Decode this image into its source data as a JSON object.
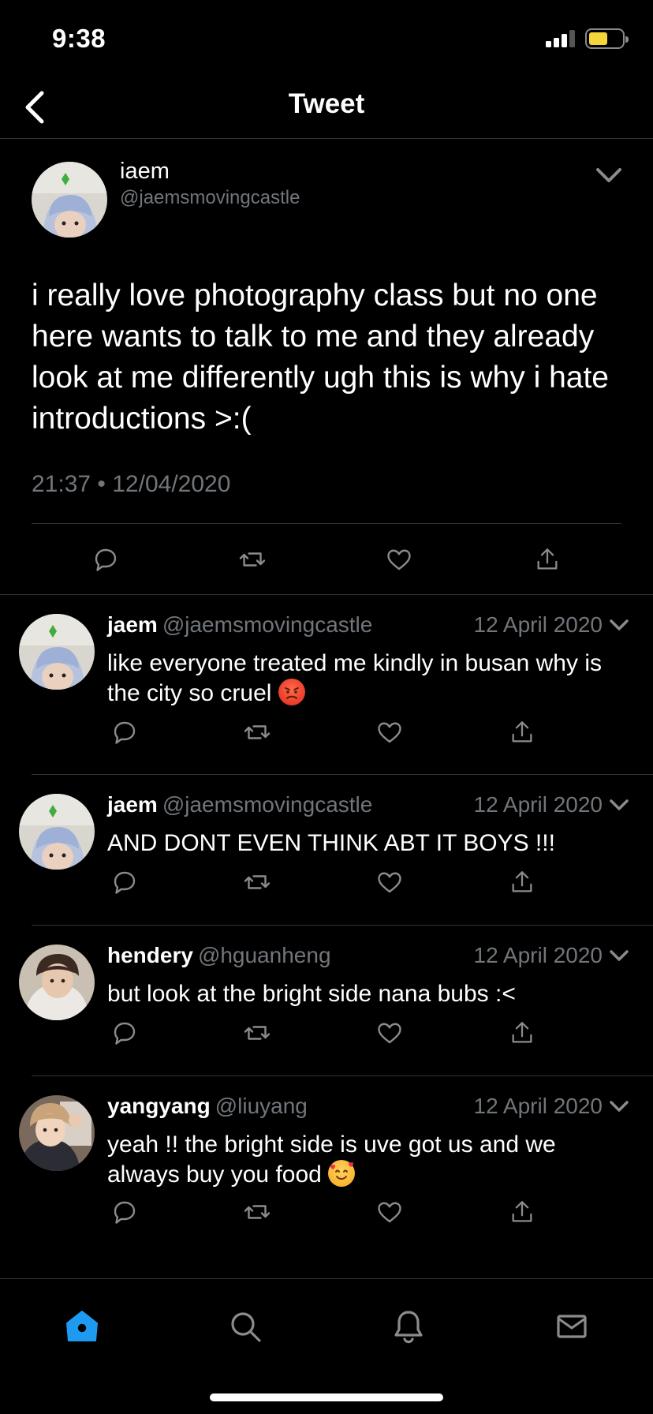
{
  "status_bar": {
    "time": "9:38"
  },
  "header": {
    "title": "Tweet",
    "back_icon": "chevron-left-icon"
  },
  "main_tweet": {
    "display_name": "iaem",
    "handle": "@jaemsmovingcastle",
    "text": "i really love photography class but no one here wants to talk to me and they already look at me differently ugh this is why i hate introductions >:(",
    "meta": "21:37 • 12/04/2020"
  },
  "replies": [
    {
      "name": "jaem",
      "handle": "@jaemsmovingcastle",
      "date": "12 April 2020",
      "text": "like everyone treated me kindly in busan why is the city so cruel",
      "emoji": "angry-face-emoji"
    },
    {
      "name": "jaem",
      "handle": "@jaemsmovingcastle",
      "date": "12 April 2020",
      "text": "AND DONT EVEN THINK ABT IT BOYS !!!"
    },
    {
      "name": "hendery",
      "handle": "@hguanheng",
      "date": "12 April 2020",
      "text": "but look at the bright side nana bubs :<"
    },
    {
      "name": "yangyang",
      "handle": "@liuyang",
      "date": "12 April 2020",
      "text": "yeah !! the bright side is uve got us and we always buy you food",
      "emoji": "smiling-face-with-hearts-emoji"
    }
  ],
  "tab_bar": {
    "tabs": [
      "home-icon",
      "search-icon",
      "bell-icon",
      "mail-icon"
    ],
    "active": "home-icon"
  },
  "colors": {
    "accent": "#1d9bf0",
    "muted": "#71767b",
    "divider": "#2f3336",
    "battery": "#f6d53b"
  }
}
